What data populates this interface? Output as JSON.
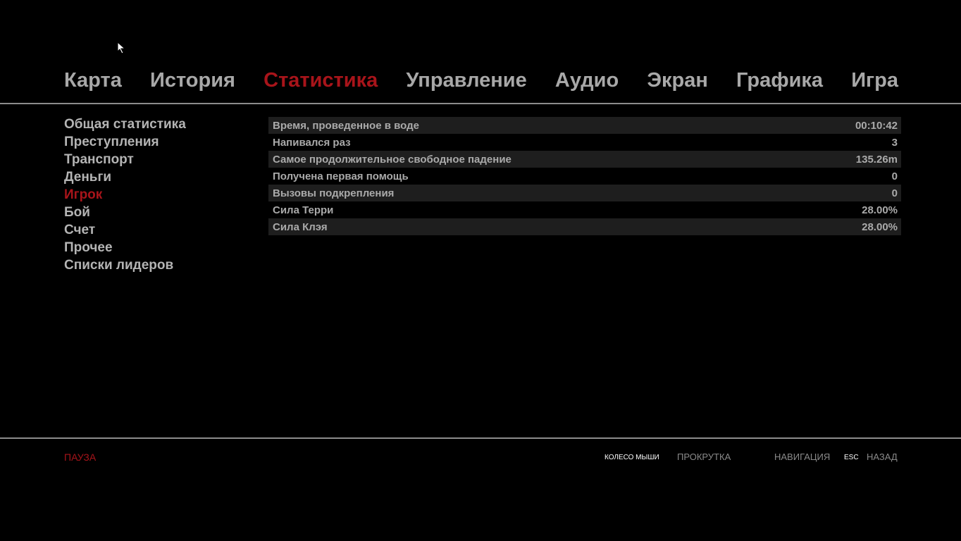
{
  "tabs": [
    {
      "label": "Карта",
      "active": false
    },
    {
      "label": "История",
      "active": false
    },
    {
      "label": "Статистика",
      "active": true
    },
    {
      "label": "Управление",
      "active": false
    },
    {
      "label": "Аудио",
      "active": false
    },
    {
      "label": "Экран",
      "active": false
    },
    {
      "label": "Графика",
      "active": false
    },
    {
      "label": "Игра",
      "active": false
    }
  ],
  "sidebar": {
    "items": [
      {
        "label": "Общая статистика"
      },
      {
        "label": "Преступления"
      },
      {
        "label": "Транспорт"
      },
      {
        "label": "Деньги"
      },
      {
        "label": "Игрок"
      },
      {
        "label": "Бой"
      },
      {
        "label": "Счет"
      },
      {
        "label": "Прочее"
      },
      {
        "label": "Списки лидеров"
      }
    ],
    "active_index": 4
  },
  "stats": {
    "rows": [
      {
        "label": "Время, проведенное в воде",
        "value": "00:10:42"
      },
      {
        "label": "Напивался раз",
        "value": "3"
      },
      {
        "label": "Самое продолжительное свободное падение",
        "value": "135.26m"
      },
      {
        "label": "Получена первая помощь",
        "value": "0"
      },
      {
        "label": "Вызовы подкрепления",
        "value": "0"
      },
      {
        "label": "Сила Терри",
        "value": "28.00%"
      },
      {
        "label": "Сила Клэя",
        "value": "28.00%"
      }
    ]
  },
  "footer": {
    "status": "ПАУЗА",
    "hints": {
      "wheel_key": "КОЛЕСО МЫШИ",
      "wheel_action": "ПРОКРУТКА",
      "nav_action": "НАВИГАЦИЯ",
      "back_key": "ESC",
      "back_action": "НАЗАД"
    }
  },
  "colors": {
    "accent": "#a8141a",
    "text": "#a8a8a8",
    "background": "#000000",
    "row_shade": "#1e1e1e"
  },
  "icons": {
    "cursor": "mouse-pointer-icon"
  }
}
